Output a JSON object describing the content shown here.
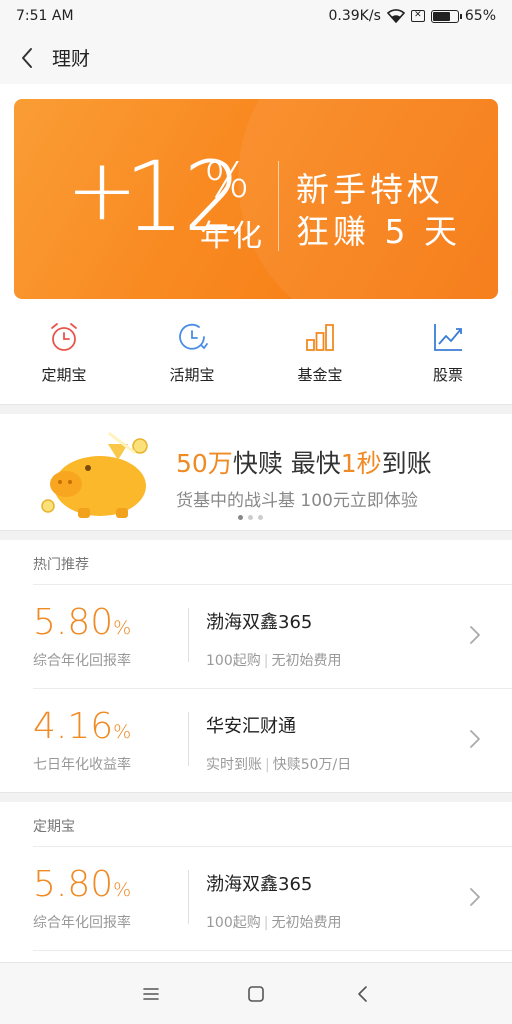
{
  "status_bar": {
    "time": "7:51 AM",
    "speed": "0.39K/s",
    "battery": "65%",
    "icons": [
      "wifi-icon",
      "sim-off-icon",
      "battery-icon"
    ]
  },
  "header": {
    "back_icon": "chevron-left-icon",
    "title": "理财"
  },
  "banner": {
    "plus": "+",
    "number": "12",
    "percent": "%",
    "annual": "年化",
    "line1": "新手特权",
    "line2": "狂赚 5 天",
    "color_start": "#fa9d35",
    "color_end": "#f6770f"
  },
  "quick_nav": [
    {
      "label": "定期宝",
      "icon": "alarm-clock-icon",
      "color": "#e8554a"
    },
    {
      "label": "活期宝",
      "icon": "clock-icon",
      "color": "#4a8de8"
    },
    {
      "label": "基金宝",
      "icon": "bar-chart-icon",
      "color": "#f08a24"
    },
    {
      "label": "股票",
      "icon": "line-chart-icon",
      "color": "#3b7dd8"
    }
  ],
  "promo": {
    "title_a": "50万",
    "title_b": "快赎 最快",
    "title_c": "1秒",
    "title_d": "到账",
    "subtitle": "货基中的战斗基 100元立即体验",
    "icon": "piggy-bank-icon",
    "carousel_pages": 3,
    "carousel_active": 1
  },
  "sections": {
    "hot": "热门推荐",
    "fixed": "定期宝"
  },
  "products": [
    {
      "rate": "5.80",
      "unit": "%",
      "rate_label": "综合年化回报率",
      "name": "渤海双鑫365",
      "desc_a": "100起购",
      "desc_b": "无初始费用"
    },
    {
      "rate": "4.16",
      "unit": "%",
      "rate_label": "七日年化收益率",
      "name": "华安汇财通",
      "desc_a": "实时到账",
      "desc_b": "快赎50万/日"
    },
    {
      "rate": "5.80",
      "unit": "%",
      "rate_label": "综合年化回报率",
      "name": "渤海双鑫365",
      "desc_a": "100起购",
      "desc_b": "无初始费用"
    }
  ],
  "accent": "#f08a24",
  "nav_bar": {
    "icons": [
      "menu-icon",
      "home-square-icon",
      "back-triangle-icon"
    ]
  }
}
